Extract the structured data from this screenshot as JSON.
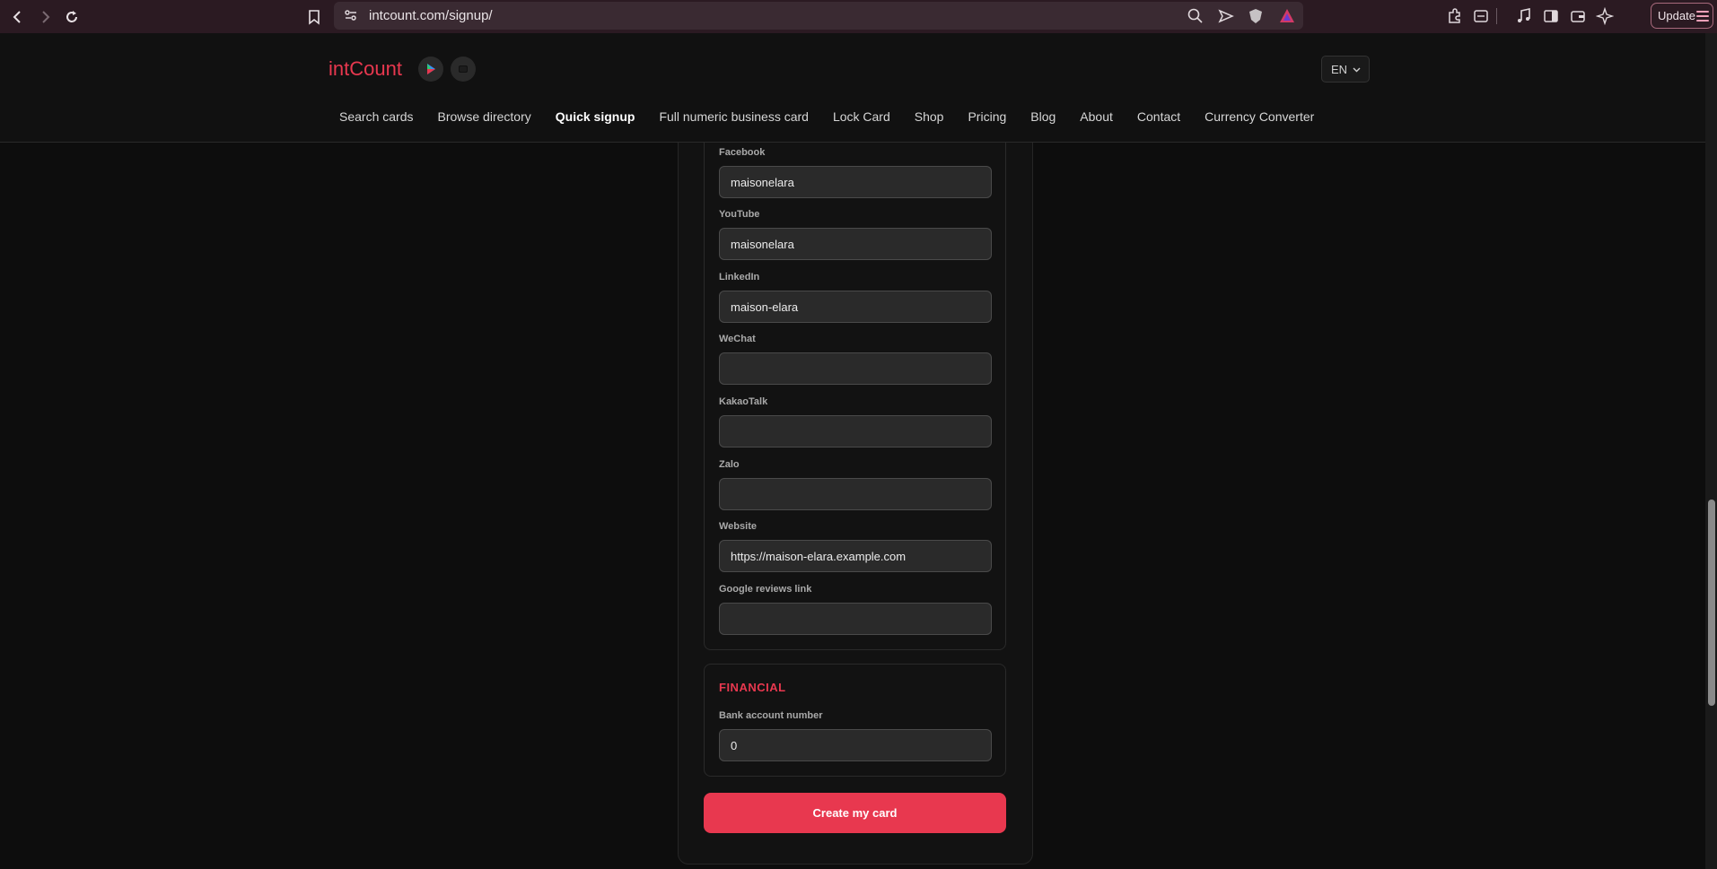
{
  "browser": {
    "url": "intcount.com/signup/",
    "update_label": "Update"
  },
  "site": {
    "logo": "intCount",
    "lang": "EN",
    "nav": [
      "Search cards",
      "Browse directory",
      "Quick signup",
      "Full numeric business card",
      "Lock Card",
      "Shop",
      "Pricing",
      "Blog",
      "About",
      "Contact",
      "Currency Converter"
    ],
    "active_nav": "Quick signup"
  },
  "form": {
    "social": [
      {
        "label": "Facebook",
        "value": "maisonelara"
      },
      {
        "label": "YouTube",
        "value": "maisonelara"
      },
      {
        "label": "LinkedIn",
        "value": "maison-elara"
      },
      {
        "label": "WeChat",
        "value": ""
      },
      {
        "label": "KakaoTalk",
        "value": ""
      },
      {
        "label": "Zalo",
        "value": ""
      },
      {
        "label": "Website",
        "value": "https://maison-elara.example.com"
      },
      {
        "label": "Google reviews link",
        "value": ""
      }
    ],
    "financial": {
      "title": "FINANCIAL",
      "bank_label": "Bank account number",
      "bank_value": "0"
    },
    "submit_label": "Create my card"
  },
  "colors": {
    "accent": "#e8384f",
    "background": "#0d0d0d"
  }
}
